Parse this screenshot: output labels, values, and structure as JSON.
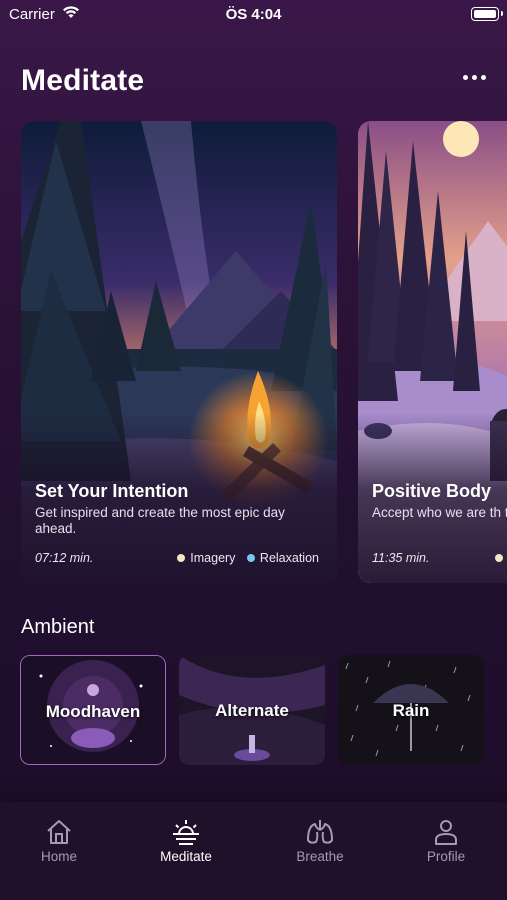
{
  "status_bar": {
    "carrier": "Carrier",
    "time": "ÖS 4:04"
  },
  "header": {
    "title": "Meditate",
    "more_icon": "ellipsis-icon"
  },
  "featured": [
    {
      "title": "Set Your Intention",
      "description": "Get inspired and create the most epic day ahead.",
      "duration": "07:12 min.",
      "tags": [
        {
          "label": "Imagery",
          "color": "#f4e6c4"
        },
        {
          "label": "Relaxation",
          "color": "#7cc4f0"
        }
      ]
    },
    {
      "title": "Positive Body",
      "description": "Accept who we are th talk, self-love and acc",
      "duration": "11:35 min.",
      "tags": [
        {
          "label": "",
          "color": "#f4e6c4"
        }
      ]
    }
  ],
  "ambient": {
    "title": "Ambient",
    "items": [
      {
        "label": "Moodhaven"
      },
      {
        "label": "Alternate"
      },
      {
        "label": "Rain"
      }
    ]
  },
  "tabs": [
    {
      "label": "Home",
      "icon": "house-icon"
    },
    {
      "label": "Meditate",
      "icon": "sunrise-icon"
    },
    {
      "label": "Breathe",
      "icon": "lungs-icon"
    },
    {
      "label": "Profile",
      "icon": "person-icon"
    }
  ],
  "active_tab": "Meditate",
  "colors": {
    "background": "#2c1238",
    "accent": "#a367c8",
    "tab_inactive": "#a699b0"
  }
}
